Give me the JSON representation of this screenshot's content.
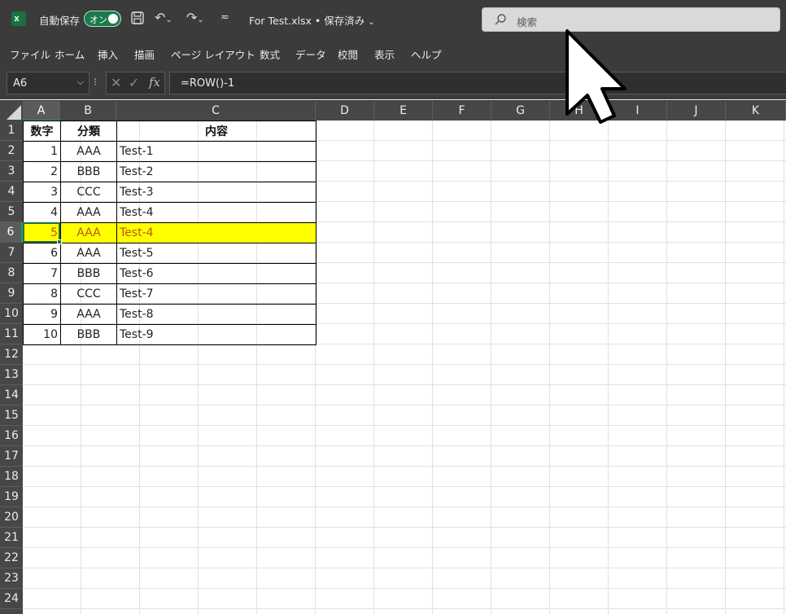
{
  "titlebar": {
    "autosave_label": "自動保存",
    "autosave_toggle": "オン",
    "doc_title": "For Test.xlsx • 保存済み",
    "search_placeholder": "検索"
  },
  "ribbon": {
    "tabs": [
      "ファイル",
      "ホーム",
      "挿入",
      "描画",
      "ページ レイアウト",
      "数式",
      "データ",
      "校閲",
      "表示",
      "ヘルプ"
    ]
  },
  "formula_bar": {
    "name_box": "A6",
    "formula": "=ROW()-1"
  },
  "columns": [
    "A",
    "B",
    "C",
    "D",
    "E",
    "F",
    "G",
    "H",
    "I",
    "J",
    "K"
  ],
  "rows": [
    "1",
    "2",
    "3",
    "4",
    "5",
    "6",
    "7",
    "8",
    "9",
    "10",
    "11",
    "12",
    "13",
    "14",
    "15",
    "16",
    "17",
    "18",
    "19",
    "20",
    "21",
    "22",
    "23",
    "24"
  ],
  "table": {
    "headers": [
      "数字",
      "分類",
      "内容"
    ],
    "rows": [
      [
        "1",
        "AAA",
        "Test-1"
      ],
      [
        "2",
        "BBB",
        "Test-2"
      ],
      [
        "3",
        "CCC",
        "Test-3"
      ],
      [
        "4",
        "AAA",
        "Test-4"
      ],
      [
        "5",
        "AAA",
        "Test-4"
      ],
      [
        "6",
        "AAA",
        "Test-5"
      ],
      [
        "7",
        "BBB",
        "Test-6"
      ],
      [
        "8",
        "CCC",
        "Test-7"
      ],
      [
        "9",
        "AAA",
        "Test-8"
      ],
      [
        "10",
        "BBB",
        "Test-9"
      ]
    ],
    "highlight_row_index": 4,
    "highlight_color": "#ffff00",
    "highlight_text_color": "#b45a0a"
  },
  "colors": {
    "chrome": "#3b3b3b",
    "accent": "#217346"
  },
  "icons": {
    "app": "excel-logo-icon",
    "save": "save-icon",
    "undo": "undo-icon",
    "redo": "redo-icon",
    "search": "search-icon",
    "cursor": "mouse-pointer-icon"
  }
}
